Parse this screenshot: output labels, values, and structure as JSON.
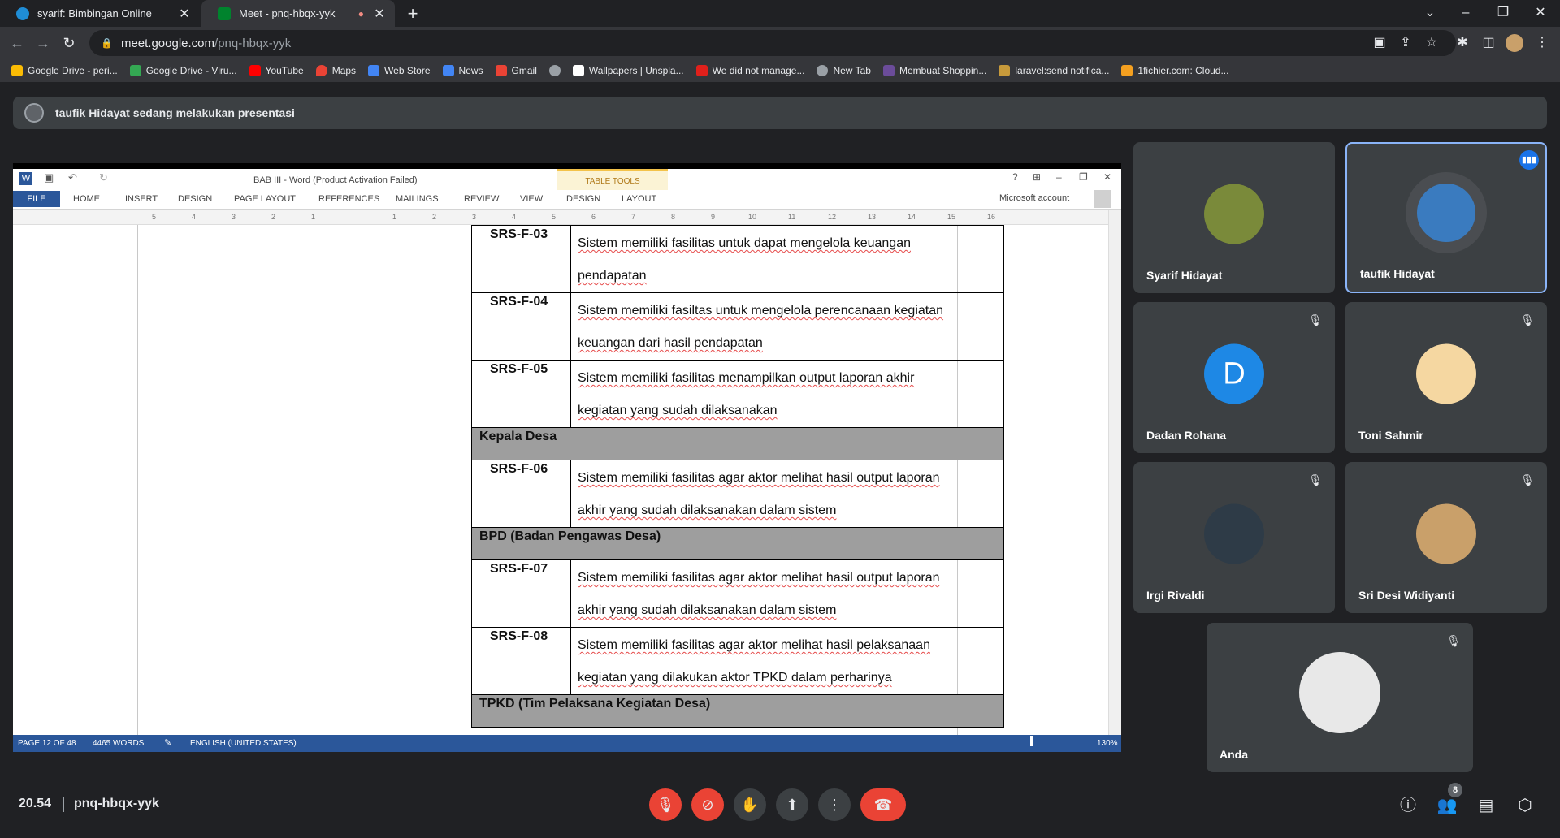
{
  "browser": {
    "tabs": [
      {
        "title": "syarif: Bimbingan Online",
        "close": "✕",
        "favicon_color": "#1f8dd6"
      },
      {
        "title": "Meet - pnq-hbqx-yyk",
        "close": "✕",
        "favicon_color": "#00832d",
        "recording": "●"
      }
    ],
    "new_tab": "+",
    "window": {
      "chevron": "⌄",
      "minimize": "–",
      "restore": "❐",
      "close": "✕"
    },
    "nav": {
      "back": "←",
      "forward": "→",
      "reload": "↻"
    },
    "url_lock": "🔒",
    "url_domain": "meet.google.com",
    "url_path": "/pnq-hbqx-yyk",
    "toolbar_icons": {
      "camera": "▣",
      "share": "⇪",
      "star": "☆",
      "extensions": "✱",
      "sidebar": "◫",
      "menu": "⋮"
    },
    "bookmarks": [
      {
        "label": "Google Drive - peri...",
        "color": "#fbbc04"
      },
      {
        "label": "Google Drive - Viru...",
        "color": "#34a853"
      },
      {
        "label": "YouTube",
        "color": "#ff0000"
      },
      {
        "label": "Maps",
        "color": "#ea4335"
      },
      {
        "label": "Web Store",
        "color": "#4285f4"
      },
      {
        "label": "News",
        "color": "#4285f4"
      },
      {
        "label": "Gmail",
        "color": "#ea4335"
      },
      {
        "label": "",
        "color": "#9aa0a6"
      },
      {
        "label": "Wallpapers | Unspla...",
        "color": "#ffffff"
      },
      {
        "label": "We did not manage...",
        "color": "#e0201b"
      },
      {
        "label": "New Tab",
        "color": "#9aa0a6"
      },
      {
        "label": "Membuat Shoppin...",
        "color": "#6b4c9a"
      },
      {
        "label": "laravel:send notifica...",
        "color": "#c79a3b"
      },
      {
        "label": "1fichier.com: Cloud...",
        "color": "#f4a020"
      }
    ]
  },
  "banner": {
    "text": "taufik Hidayat sedang melakukan presentasi"
  },
  "word": {
    "title": "BAB III - Word (Product Activation Failed)",
    "table_tools": "TABLE TOOLS",
    "tabs": [
      "FILE",
      "HOME",
      "INSERT",
      "DESIGN",
      "PAGE LAYOUT",
      "REFERENCES",
      "MAILINGS",
      "REVIEW",
      "VIEW",
      "DESIGN",
      "LAYOUT"
    ],
    "account": "Microsoft account",
    "window_btns": [
      "?",
      "⊞",
      "–",
      "❐",
      "✕"
    ],
    "ruler": [
      "5",
      "4",
      "3",
      "2",
      "1",
      "",
      "1",
      "2",
      "3",
      "4",
      "5",
      "6",
      "7",
      "8",
      "9",
      "10",
      "11",
      "12",
      "13",
      "14",
      "15",
      "16"
    ],
    "rows": [
      {
        "type": "req",
        "id": "SRS-F-03",
        "line1": "Sistem memiliki fasilitas untuk  dapat mengelola keuangan",
        "line2": "pendapatan"
      },
      {
        "type": "req",
        "id": "SRS-F-04",
        "line1": "Sistem memiliki fasiltas untuk mengelola perencanaan kegiatan",
        "line2": "keuangan dari hasil pendapatan"
      },
      {
        "type": "req",
        "id": "SRS-F-05",
        "line1": "Sistem memiliki fasilitas menampilkan output laporan akhir",
        "line2": "kegiatan yang sudah dilaksanakan"
      },
      {
        "type": "grp",
        "label": "Kepala Desa"
      },
      {
        "type": "req",
        "id": "SRS-F-06",
        "line1": "Sistem memiliki fasilitas agar aktor melihat hasil output laporan",
        "line2": "akhir yang sudah dilaksanakan dalam sistem"
      },
      {
        "type": "grp",
        "label": "BPD (Badan Pengawas Desa)"
      },
      {
        "type": "req",
        "id": "SRS-F-07",
        "line1": "Sistem memiliki fasilitas agar aktor melihat hasil output laporan",
        "line2": "akhir yang sudah dilaksanakan dalam sistem"
      },
      {
        "type": "req",
        "id": "SRS-F-08",
        "line1": "Sistem memiliki fasilitas agar aktor melihat hasil pelaksanaan",
        "line2": "kegiatan yang dilakukan aktor TPKD dalam perharinya"
      },
      {
        "type": "grp",
        "label": "TPKD (Tim Pelaksana Kegiatan Desa)"
      }
    ],
    "status": {
      "page": "PAGE 12 OF 48",
      "words": "4465 WORDS",
      "language": "ENGLISH (UNITED STATES)",
      "zoom": "130%"
    }
  },
  "participants": [
    {
      "name": "Syarif Hidayat",
      "avatar_color": "#7a8a3a",
      "muted": false
    },
    {
      "name": "taufik Hidayat",
      "avatar_color": "#3a7bbf",
      "muted": false,
      "speaking": true
    },
    {
      "name": "Dadan Rohana",
      "avatar_letter": "D",
      "avatar_color": "#1e88e5",
      "muted": true
    },
    {
      "name": "Toni Sahmir",
      "avatar_color": "#f5d7a1",
      "muted": true
    },
    {
      "name": "Irgi Rivaldi",
      "avatar_color": "#2e3b47",
      "muted": true
    },
    {
      "name": "Sri Desi Widiyanti",
      "avatar_color": "#c9a06a",
      "muted": true
    },
    {
      "name": "Anda",
      "avatar_color": "#e8e8e8",
      "muted": true
    }
  ],
  "icons": {
    "mic_off": "🎙",
    "speaking": "▮▮▮"
  },
  "meet_bar": {
    "time": "20.54",
    "code": "pnq-hbqx-yyk",
    "controls": {
      "mic": "🎙",
      "cam": "⊘",
      "hand": "✋",
      "present": "⬆",
      "more": "⋮",
      "end": "☎"
    },
    "right": {
      "info": "ⓘ",
      "people": "👥",
      "chat": "▤",
      "activities": "⬡"
    },
    "participant_count": "8"
  }
}
